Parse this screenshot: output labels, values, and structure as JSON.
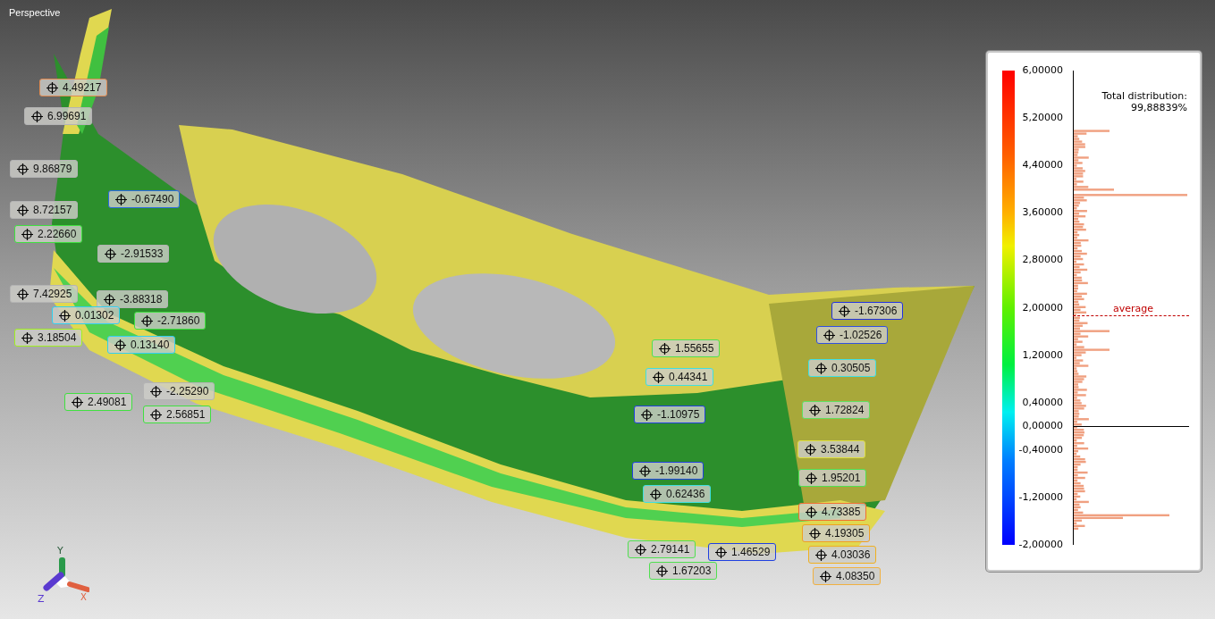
{
  "viewport": {
    "title": "Perspective"
  },
  "labels": [
    {
      "value": "4.49217",
      "color": "#e08a50"
    },
    {
      "value": "6.99691",
      "color": "#b4b4b4"
    },
    {
      "value": "9.86879",
      "color": "#b4b4b4"
    },
    {
      "value": "-0.67490",
      "color": "#2a6ae0"
    },
    {
      "value": "8.72157",
      "color": "#b4b4b4"
    },
    {
      "value": "2.22660",
      "color": "#40e040"
    },
    {
      "value": "-2.91533",
      "color": "#b4b4b4"
    },
    {
      "value": "7.42925",
      "color": "#b4b4b4"
    },
    {
      "value": "-3.88318",
      "color": "#b4b4b4"
    },
    {
      "value": "0.01302",
      "color": "#30d0f0"
    },
    {
      "value": "-2.71860",
      "color": "#40e040"
    },
    {
      "value": "3.18504",
      "color": "#a0f020"
    },
    {
      "value": "0.13140",
      "color": "#30d0f0"
    },
    {
      "value": "-2.25290",
      "color": "#b4b4b4"
    },
    {
      "value": "2.49081",
      "color": "#40e040"
    },
    {
      "value": "2.56851",
      "color": "#40e040"
    },
    {
      "value": "1.55655",
      "color": "#50e050"
    },
    {
      "value": "0.44341",
      "color": "#40e0e0"
    },
    {
      "value": "-1.10975",
      "color": "#2040e0"
    },
    {
      "value": "-1.99140",
      "color": "#2040e0"
    },
    {
      "value": "0.62436",
      "color": "#40e0e0"
    },
    {
      "value": "2.79141",
      "color": "#50e050"
    },
    {
      "value": "1.46529",
      "color": "#2040e0"
    },
    {
      "value": "1.67203",
      "color": "#50e050"
    },
    {
      "value": "-1.67306",
      "color": "#2030e0"
    },
    {
      "value": "-1.02526",
      "color": "#3050e0"
    },
    {
      "value": "0.30505",
      "color": "#40e0e0"
    },
    {
      "value": "1.72824",
      "color": "#60e060"
    },
    {
      "value": "3.53844",
      "color": "#e0e040"
    },
    {
      "value": "1.95201",
      "color": "#50e050"
    },
    {
      "value": "4.73385",
      "color": "#f07030"
    },
    {
      "value": "4.19305",
      "color": "#f0a020"
    },
    {
      "value": "4.03036",
      "color": "#f0b020"
    },
    {
      "value": "4.08350",
      "color": "#f0b040"
    }
  ],
  "legend": {
    "ticks": [
      "6,00000",
      "5,20000",
      "4,40000",
      "3,60000",
      "2,80000",
      "2,00000",
      "1,20000",
      "0,40000",
      "0,00000",
      "-0,40000",
      "-1,20000",
      "-2,00000"
    ],
    "total_label": "Total distribution:",
    "total_value": "99,88839%",
    "average_label": "average"
  },
  "axis_triad": {
    "labels": [
      "Y",
      "Z",
      "X"
    ]
  }
}
